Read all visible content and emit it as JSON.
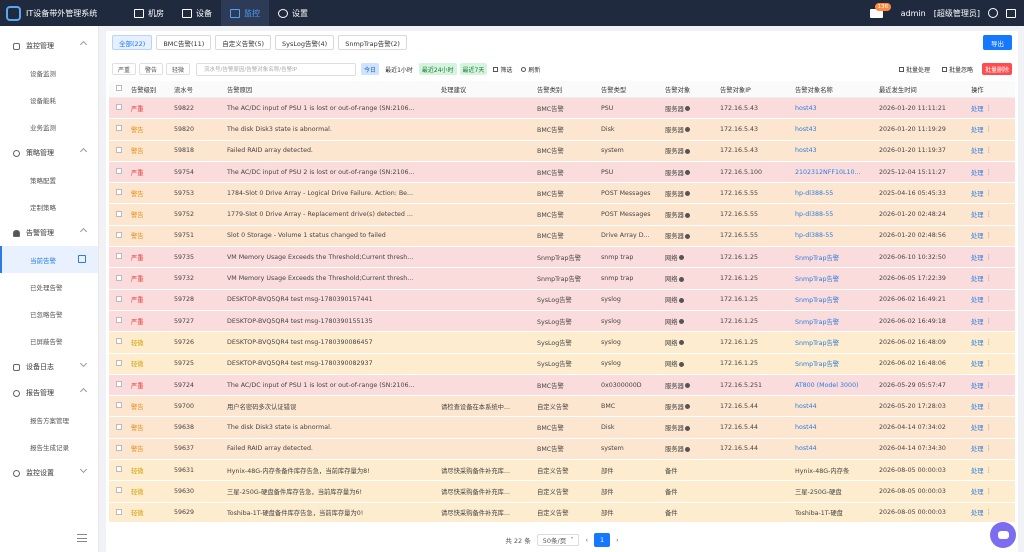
{
  "app": {
    "title": "IT设备带外管理系统"
  },
  "topnav": [
    {
      "label": "机房",
      "icon": "bar-chart-icon",
      "active": false
    },
    {
      "label": "设备",
      "icon": "grid-icon",
      "active": false
    },
    {
      "label": "监控",
      "icon": "monitor-icon",
      "active": true
    },
    {
      "label": "设置",
      "icon": "gear-icon",
      "active": false
    }
  ],
  "user": {
    "mail_count": "136",
    "name": "admin",
    "role": "[超级管理员]"
  },
  "sidebar": {
    "groups": [
      {
        "label": "监控管理",
        "icon": "monitor-icon",
        "items": [
          "设备监测",
          "设备能耗",
          "业务监测"
        ]
      },
      {
        "label": "策略管理",
        "icon": "location-icon",
        "items": [
          "策略配置",
          "定制策略"
        ]
      },
      {
        "label": "告警管理",
        "icon": "bell-icon",
        "items": [
          "当前告警",
          "已处理告警",
          "已忽略告警",
          "已屏蔽告警"
        ]
      },
      {
        "label": "设备日志",
        "icon": "log-icon",
        "items": []
      },
      {
        "label": "报告管理",
        "icon": "report-icon",
        "items": [
          "报告方案管理",
          "报告生成记录"
        ]
      },
      {
        "label": "监控设置",
        "icon": "gear-icon",
        "items": []
      }
    ],
    "active_item": "当前告警"
  },
  "tabs": [
    "全部(22)",
    "BMC告警(11)",
    "自定义告警(5)",
    "SysLog告警(4)",
    "SnmpTrap告警(2)"
  ],
  "export_label": "导出",
  "filters": {
    "levels": [
      "严重",
      "警告",
      "轻微"
    ],
    "search_placeholder": "流水号/告警原因/告警对象名称/告警IP",
    "time_buttons": [
      "今日",
      "最近1小时",
      "最近24小时",
      "最近7天"
    ],
    "filter_label": "筛选",
    "reset_label": "刷新",
    "batch_process": "批量处理",
    "batch_ignore": "批量忽略",
    "batch_delete": "批量删除"
  },
  "table": {
    "columns": [
      "告警级别",
      "流水号",
      "告警原因",
      "处理建议",
      "告警类别",
      "告警类型",
      "告警对象",
      "告警对象IP",
      "告警对象名称",
      "最近发生时间",
      "操作"
    ],
    "action_label": "处理",
    "rows": [
      {
        "level": "严重",
        "id": "59822",
        "reason": "The AC/DC input of PSU 1 is lost or out-of-range (SN:2106...",
        "advice": "",
        "category": "BMC告警",
        "type": "PSU",
        "object": "服务器",
        "ip": "172.16.5.43",
        "name": "host43",
        "time": "2026-01-20 11:11:21"
      },
      {
        "level": "警告",
        "id": "59820",
        "reason": "The disk Disk3 state is abnormal.",
        "advice": "",
        "category": "BMC告警",
        "type": "Disk",
        "object": "服务器",
        "ip": "172.16.5.43",
        "name": "host43",
        "time": "2026-01-20 11:19:29"
      },
      {
        "level": "警告",
        "id": "59818",
        "reason": "Failed RAID array detected.",
        "advice": "",
        "category": "BMC告警",
        "type": "system",
        "object": "服务器",
        "ip": "172.16.5.43",
        "name": "host43",
        "time": "2026-01-20 11:19:37"
      },
      {
        "level": "严重",
        "id": "59754",
        "reason": "The AC/DC input of PSU 2 is lost or out-of-range (SN:2106...",
        "advice": "",
        "category": "BMC告警",
        "type": "PSU",
        "object": "服务器",
        "ip": "172.16.5.100",
        "name": "2102312NFF10L10...",
        "time": "2025-12-04 15:11:27"
      },
      {
        "level": "警告",
        "id": "59753",
        "reason": "1784-Slot 0 Drive Array - Logical Drive Failure. Action: Be...",
        "advice": "",
        "category": "BMC告警",
        "type": "POST Messages",
        "object": "服务器",
        "ip": "172.16.5.55",
        "name": "hp-dl388-55",
        "time": "2025-04-16 05:45:33"
      },
      {
        "level": "警告",
        "id": "59752",
        "reason": "1779-Slot 0 Drive Array - Replacement drive(s) detected ...",
        "advice": "",
        "category": "BMC告警",
        "type": "POST Messages",
        "object": "服务器",
        "ip": "172.16.5.55",
        "name": "hp-dl388-55",
        "time": "2026-01-20 02:48:24"
      },
      {
        "level": "警告",
        "id": "59751",
        "reason": "Slot 0 Storage - Volume 1 status changed to failed",
        "advice": "",
        "category": "BMC告警",
        "type": "Drive Array D...",
        "object": "服务器",
        "ip": "172.16.5.55",
        "name": "hp-dl388-55",
        "time": "2026-01-20 02:48:56"
      },
      {
        "level": "严重",
        "id": "59735",
        "reason": "VM Memory Usage Exceeds the Threshold;Current thresh...",
        "advice": "",
        "category": "SnmpTrap告警",
        "type": "snmp trap",
        "object": "网络",
        "ip": "172.16.1.25",
        "name": "SnmpTrap告警",
        "time": "2026-06-10 10:32:50"
      },
      {
        "level": "严重",
        "id": "59732",
        "reason": "VM Memory Usage Exceeds the Threshold;Current thresh...",
        "advice": "",
        "category": "SnmpTrap告警",
        "type": "snmp trap",
        "object": "网络",
        "ip": "172.16.1.25",
        "name": "SnmpTrap告警",
        "time": "2026-06-05 17:22:39"
      },
      {
        "level": "严重",
        "id": "59728",
        "reason": "DESKTOP-BVQ5QR4 test msg-1780390157441",
        "advice": "",
        "category": "SysLog告警",
        "type": "syslog",
        "object": "网络",
        "ip": "172.16.1.25",
        "name": "SnmpTrap告警",
        "time": "2026-06-02 16:49:21"
      },
      {
        "level": "严重",
        "id": "59727",
        "reason": "DESKTOP-BVQ5QR4 test msg-1780390155135",
        "advice": "",
        "category": "SysLog告警",
        "type": "syslog",
        "object": "网络",
        "ip": "172.16.1.25",
        "name": "SnmpTrap告警",
        "time": "2026-06-02 16:49:18"
      },
      {
        "level": "轻微",
        "id": "59726",
        "reason": "DESKTOP-BVQ5QR4 test msg-1780390086457",
        "advice": "",
        "category": "SysLog告警",
        "type": "syslog",
        "object": "网络",
        "ip": "172.16.1.25",
        "name": "SnmpTrap告警",
        "time": "2026-06-02 16:48:09"
      },
      {
        "level": "轻微",
        "id": "59725",
        "reason": "DESKTOP-BVQ5QR4 test msg-1780390082937",
        "advice": "",
        "category": "SysLog告警",
        "type": "syslog",
        "object": "网络",
        "ip": "172.16.1.25",
        "name": "SnmpTrap告警",
        "time": "2026-06-02 16:48:06"
      },
      {
        "level": "严重",
        "id": "59724",
        "reason": "The AC/DC input of PSU 1 is lost or out-of-range (SN:2106...",
        "advice": "",
        "category": "BMC告警",
        "type": "0x0300000D",
        "object": "服务器",
        "ip": "172.16.5.251",
        "name": "AT800 (Model 3000)",
        "time": "2026-05-29 05:57:47"
      },
      {
        "level": "警告",
        "id": "59700",
        "reason": "用户名密码多次认证错误",
        "advice": "请检查设备在本系统中...",
        "category": "自定义告警",
        "type": "BMC",
        "object": "服务器",
        "ip": "172.16.5.44",
        "name": "host44",
        "time": "2026-05-20 17:28:03"
      },
      {
        "level": "警告",
        "id": "59638",
        "reason": "The disk Disk3 state is abnormal.",
        "advice": "",
        "category": "BMC告警",
        "type": "Disk",
        "object": "服务器",
        "ip": "172.16.5.44",
        "name": "host44",
        "time": "2026-04-14 07:34:02"
      },
      {
        "level": "警告",
        "id": "59637",
        "reason": "Failed RAID array detected.",
        "advice": "",
        "category": "BMC告警",
        "type": "system",
        "object": "服务器",
        "ip": "172.16.5.44",
        "name": "host44",
        "time": "2026-04-14 07:34:30"
      },
      {
        "level": "轻微",
        "id": "59631",
        "reason": "Hynix-48G-内存条备件库存告急，当前库存量为8!",
        "advice": "请尽快采购备件补充库...",
        "category": "自定义告警",
        "type": "部件",
        "object": "备件",
        "ip": "",
        "name": "Hynix-48G-内存条",
        "time": "2026-08-05 00:00:03"
      },
      {
        "level": "轻微",
        "id": "59630",
        "reason": "三星-250G-硬盘备件库存告急，当前库存量为6!",
        "advice": "请尽快采购备件补充库...",
        "category": "自定义告警",
        "type": "部件",
        "object": "备件",
        "ip": "",
        "name": "三星-250G-硬盘",
        "time": "2026-08-05 00:00:03"
      },
      {
        "level": "轻微",
        "id": "59629",
        "reason": "Toshiba-1T-硬盘备件库存告急，当前库存量为0!",
        "advice": "请尽快采购备件补充库...",
        "category": "自定义告警",
        "type": "部件",
        "object": "备件",
        "ip": "",
        "name": "Toshiba-1T-硬盘",
        "time": "2026-08-05 00:00:03"
      }
    ]
  },
  "pagination": {
    "total": "共 22 条",
    "page_size": "50条/页",
    "current": "1"
  },
  "colors": {
    "severe_bg": "#fbdcdc",
    "warn_bg": "#fde6cf",
    "mild_bg": "#fdeccd",
    "accent": "#1677ff",
    "topbar": "#1f2a3f"
  }
}
